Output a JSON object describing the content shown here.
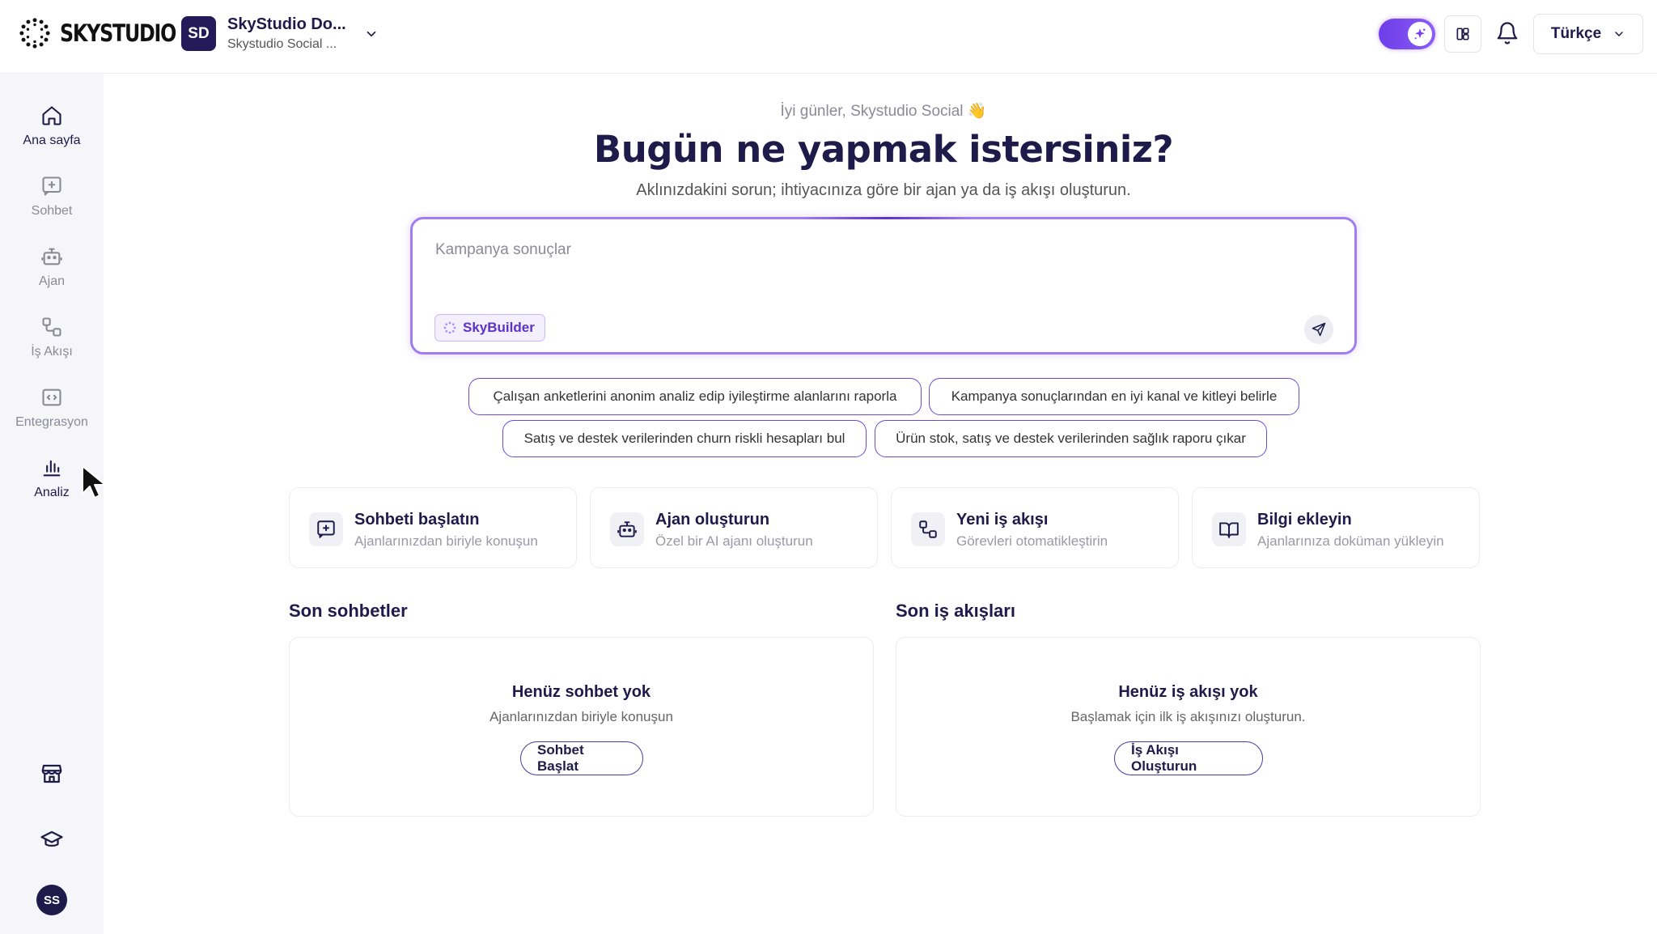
{
  "app": {
    "logo_text": "SKYSTUDIO"
  },
  "workspace": {
    "initials": "SD",
    "name": "SkyStudio Do...",
    "subtitle": "Skystudio Social ..."
  },
  "header": {
    "language": "Türkçe"
  },
  "sidebar": {
    "items": [
      {
        "label": "Ana sayfa",
        "icon": "home-icon",
        "active": true
      },
      {
        "label": "Sohbet",
        "icon": "chat-plus-icon",
        "active": false
      },
      {
        "label": "Ajan",
        "icon": "robot-icon",
        "active": false
      },
      {
        "label": "İş Akışı",
        "icon": "workflow-icon",
        "active": false
      },
      {
        "label": "Entegrasyon",
        "icon": "code-box-icon",
        "active": false
      },
      {
        "label": "Analiz",
        "icon": "bar-chart-icon",
        "active": false
      }
    ],
    "user_initials": "SS"
  },
  "main": {
    "greeting": "İyi günler, Skystudio Social 👋",
    "headline": "Bugün ne yapmak istersiniz?",
    "subhead": "Aklınızdakini sorun; ihtiyacınıza göre bir ajan ya da iş akışı oluşturun.",
    "prompt": {
      "value": "Kampanya sonuçlar",
      "builder_label": "SkyBuilder"
    },
    "suggestions": [
      "Çalışan anketlerini anonim analiz edip iyileştirme alanlarını raporla",
      "Kampanya sonuçlarından en iyi kanal ve kitleyi belirle",
      "Satış ve destek verilerinden churn riskli hesapları bul",
      "Ürün stok, satış ve destek verilerinden sağlık raporu çıkar"
    ],
    "quick_actions": [
      {
        "title": "Sohbeti başlatın",
        "subtitle": "Ajanlarınızdan biriyle konuşun",
        "icon": "chat-plus-icon"
      },
      {
        "title": "Ajan oluşturun",
        "subtitle": "Özel bir AI ajanı oluşturun",
        "icon": "robot-icon"
      },
      {
        "title": "Yeni iş akışı",
        "subtitle": "Görevleri otomatikleştirin",
        "icon": "workflow-icon"
      },
      {
        "title": "Bilgi ekleyin",
        "subtitle": "Ajanlarınıza doküman yükleyin",
        "icon": "book-icon"
      }
    ],
    "recent_chats": {
      "title": "Son sohbetler",
      "empty_title": "Henüz sohbet yok",
      "empty_subtitle": "Ajanlarınızdan biriyle konuşun",
      "button": "Sohbet Başlat"
    },
    "recent_workflows": {
      "title": "Son iş akışları",
      "empty_title": "Henüz iş akışı yok",
      "empty_subtitle": "Başlamak için ilk iş akışınızı oluşturun.",
      "button": "İş Akışı Oluşturun"
    }
  },
  "colors": {
    "brand": "#1e1b4b",
    "accent": "#7c3aed",
    "sidebar_bg": "#f6f6fa"
  }
}
